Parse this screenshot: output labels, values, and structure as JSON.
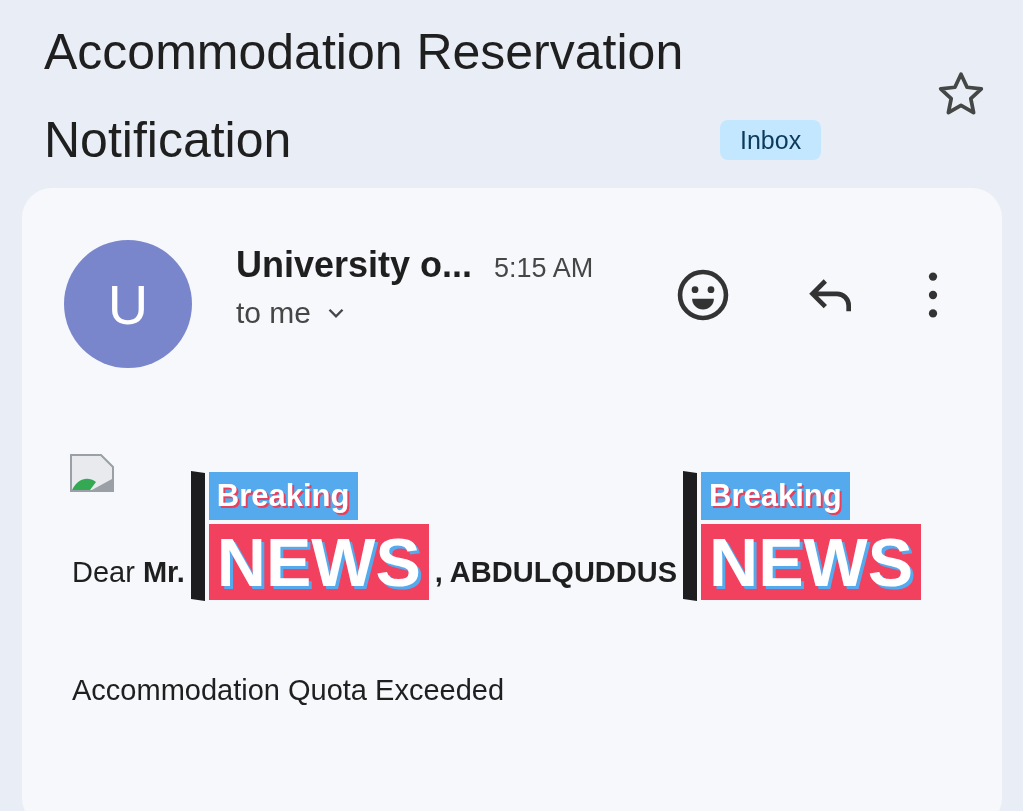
{
  "subject": "Accommodation Reservation Notification",
  "label": "Inbox",
  "starred": false,
  "message": {
    "avatar_letter": "U",
    "sender": "University o...",
    "time": "5:15 AM",
    "recipient": "to me",
    "greeting": [
      "Dear **Mr.**",
      "**, ABDULQUDDUS**"
    ],
    "body": "Accommodation Quota Exceeded"
  },
  "overlays": [
    {
      "top": "Breaking",
      "bottom": "NEWS"
    },
    {
      "top": "Breaking",
      "bottom": "NEWS"
    }
  ]
}
